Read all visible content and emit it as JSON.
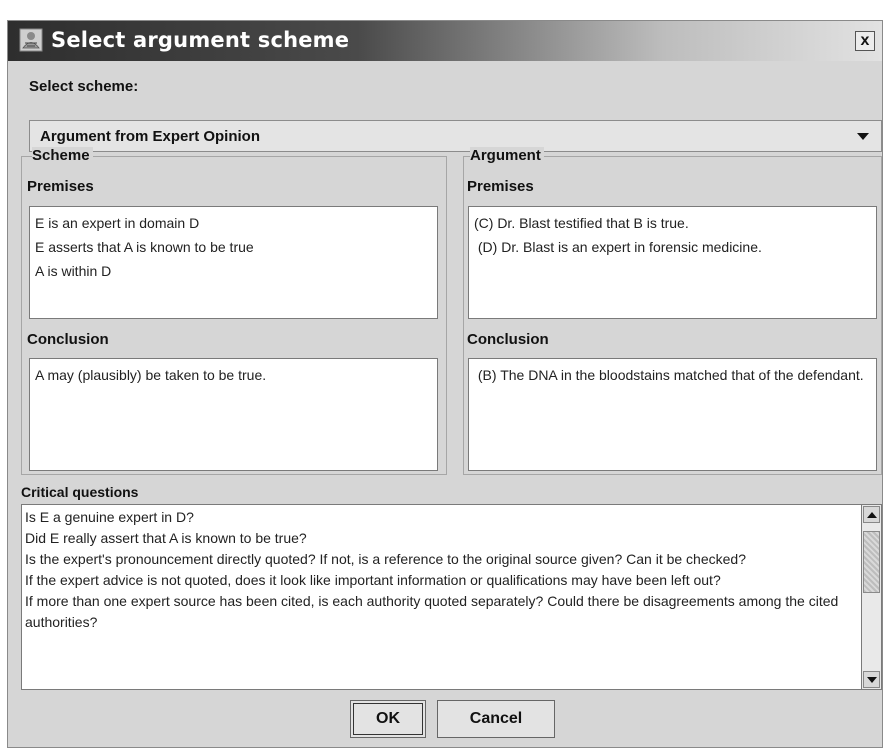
{
  "window": {
    "title": "Select argument scheme",
    "close_label": "x",
    "icon": "app-icon"
  },
  "select_scheme": {
    "label": "Select scheme:",
    "selected": "Argument from Expert Opinion"
  },
  "scheme": {
    "group_title": "Scheme",
    "premises_label": "Premises",
    "premises": [
      "E is an expert in domain D",
      "E asserts that A is known to be true",
      "A is within D"
    ],
    "conclusion_label": "Conclusion",
    "conclusion": "A may (plausibly) be taken to be true."
  },
  "argument": {
    "group_title": "Argument",
    "premises_label": "Premises",
    "premises": [
      "(C) Dr. Blast testified that B is true.",
      " (D) Dr. Blast is an expert in forensic medicine."
    ],
    "conclusion_label": "Conclusion",
    "conclusion": " (B) The DNA in the bloodstains matched that of the defendant."
  },
  "critical_questions": {
    "label": "Critical questions",
    "items": [
      "Is E a genuine expert in D?",
      "Did E really assert that A is known to be true?",
      "Is the expert's pronouncement directly quoted? If not, is a reference to the original source given? Can it be checked?",
      "If the expert advice is not quoted, does it look like important information or qualifications may have been left out?",
      "If more than one expert source has been cited, is each authority quoted separately? Could there be disagreements among the cited authorities?"
    ]
  },
  "buttons": {
    "ok": "OK",
    "cancel": "Cancel"
  }
}
